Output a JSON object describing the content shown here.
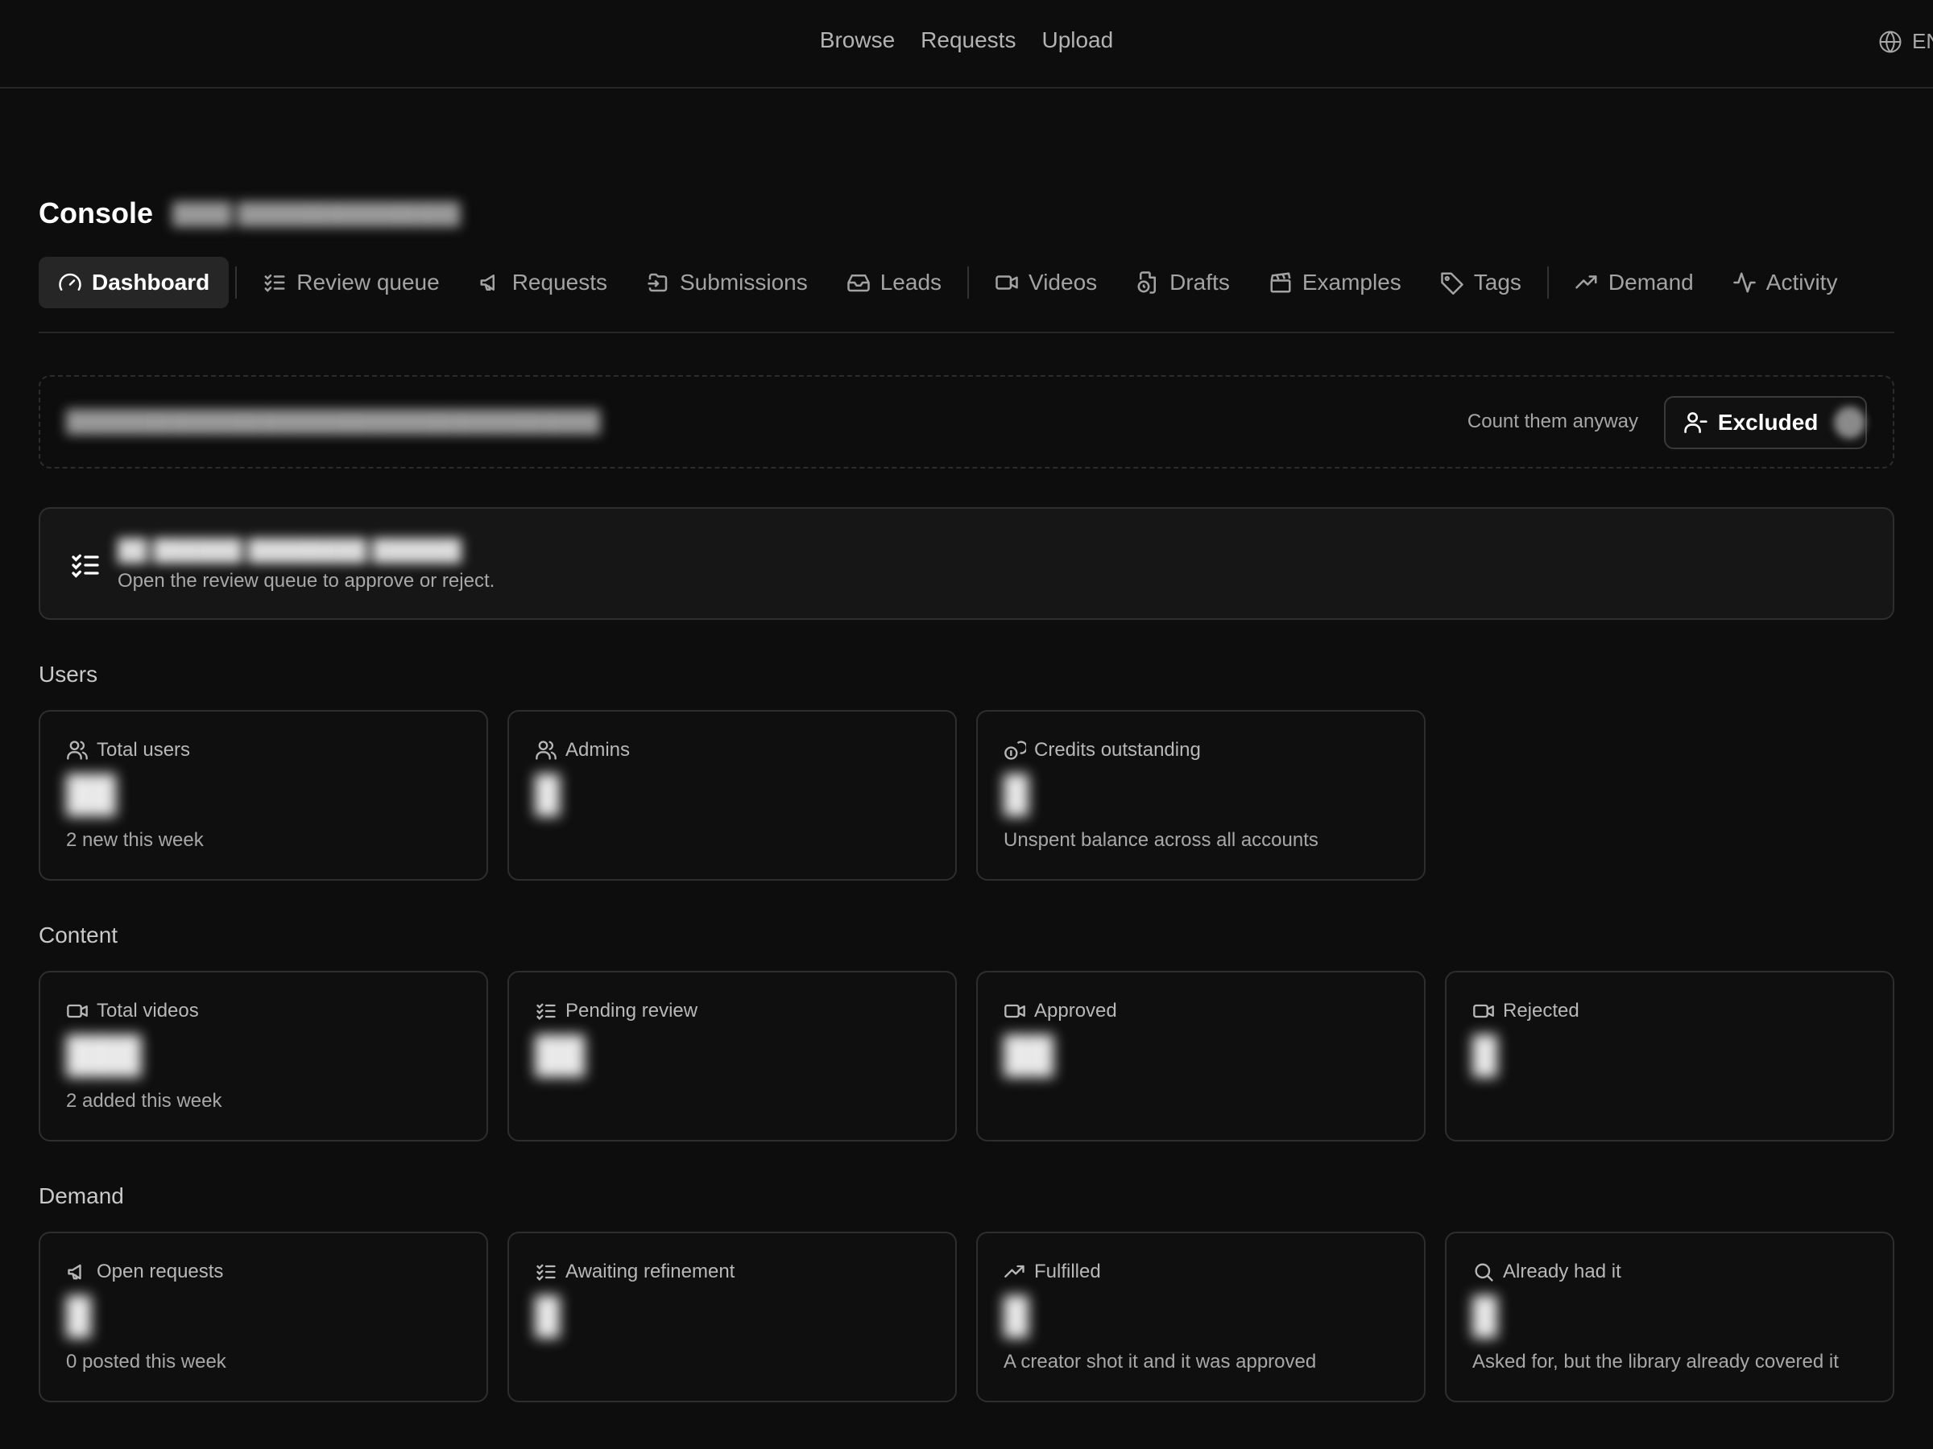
{
  "topbar": {
    "nav": [
      "Browse",
      "Requests",
      "Upload"
    ],
    "lang_icon": "globe-icon",
    "lang": "EN"
  },
  "page": {
    "title": "Console",
    "subtitle_redacted": "████ ███████████████"
  },
  "tabs": [
    {
      "label": "Dashboard",
      "icon": "gauge-icon",
      "active": true
    },
    {
      "label": "Review queue",
      "icon": "list-checks-icon"
    },
    {
      "label": "Requests",
      "icon": "megaphone-icon"
    },
    {
      "label": "Submissions",
      "icon": "folder-input-icon"
    },
    {
      "label": "Leads",
      "icon": "inbox-icon"
    },
    {
      "label": "Videos",
      "icon": "video-icon"
    },
    {
      "label": "Drafts",
      "icon": "file-clock-icon"
    },
    {
      "label": "Examples",
      "icon": "clapperboard-icon"
    },
    {
      "label": "Tags",
      "icon": "tag-icon"
    },
    {
      "label": "Demand",
      "icon": "trending-up-icon"
    },
    {
      "label": "Activity",
      "icon": "activity-icon"
    }
  ],
  "exclusion": {
    "text_redacted": "████████████████████████████████████",
    "count_label": "Count them anyway",
    "button_label": "Excluded",
    "button_icon": "user-minus-icon"
  },
  "review_banner": {
    "icon": "list-checks-icon",
    "title_redacted": "██ ██████ ████████ ██████",
    "subtitle": "Open the review queue to approve or reject."
  },
  "sections": {
    "users": {
      "label": "Users",
      "cards": [
        {
          "label": "Total users",
          "icon": "users-icon",
          "value": "██",
          "note": "2 new this week"
        },
        {
          "label": "Admins",
          "icon": "users-icon",
          "value": "█",
          "note": ""
        },
        {
          "label": "Credits outstanding",
          "icon": "coins-icon",
          "value": "█",
          "note": "Unspent balance across all accounts"
        }
      ]
    },
    "content": {
      "label": "Content",
      "cards": [
        {
          "label": "Total videos",
          "icon": "video-icon",
          "value": "███",
          "note": "2 added this week"
        },
        {
          "label": "Pending review",
          "icon": "list-checks-icon",
          "value": "██",
          "note": ""
        },
        {
          "label": "Approved",
          "icon": "video-icon",
          "value": "██",
          "note": ""
        },
        {
          "label": "Rejected",
          "icon": "video-icon",
          "value": "█",
          "note": ""
        }
      ]
    },
    "demand": {
      "label": "Demand",
      "cards": [
        {
          "label": "Open requests",
          "icon": "megaphone-icon",
          "value": "█",
          "note": "0 posted this week"
        },
        {
          "label": "Awaiting refinement",
          "icon": "list-checks-icon",
          "value": "█",
          "note": ""
        },
        {
          "label": "Fulfilled",
          "icon": "trending-up-icon",
          "value": "█",
          "note": "A creator shot it and it was approved"
        },
        {
          "label": "Already had it",
          "icon": "search-icon",
          "value": "█",
          "note": "Asked for, but the library already covered it"
        }
      ]
    }
  }
}
